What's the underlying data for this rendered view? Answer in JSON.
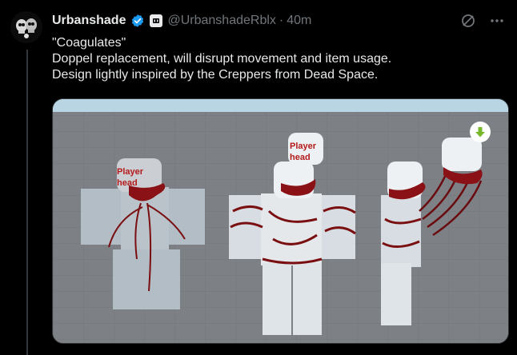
{
  "post": {
    "display_name": "Urbanshade",
    "handle": "@UrbanshadeRblx",
    "separator": "·",
    "time": "40m",
    "text_lines": [
      "\"Coagulates\"",
      "Doppel replacement, will disrupt movement and item usage.",
      "Design lightly inspired by the Creppers from Dead Space."
    ]
  },
  "media": {
    "head_label_1a": "Player",
    "head_label_1b": "head",
    "head_label_2a": "Player",
    "head_label_2b": "head"
  },
  "colors": {
    "background": "#000000",
    "text": "#e7e9ea",
    "muted": "#71767b",
    "verified": "#1d9bf0",
    "download_green": "#76b82a",
    "blood": "#7a0f12"
  },
  "icons": {
    "verified": "verified-badge-icon",
    "affiliate": "affiliate-badge-icon",
    "grok": "grok-icon",
    "more": "more-dots-icon",
    "download": "download-arrow-icon"
  }
}
